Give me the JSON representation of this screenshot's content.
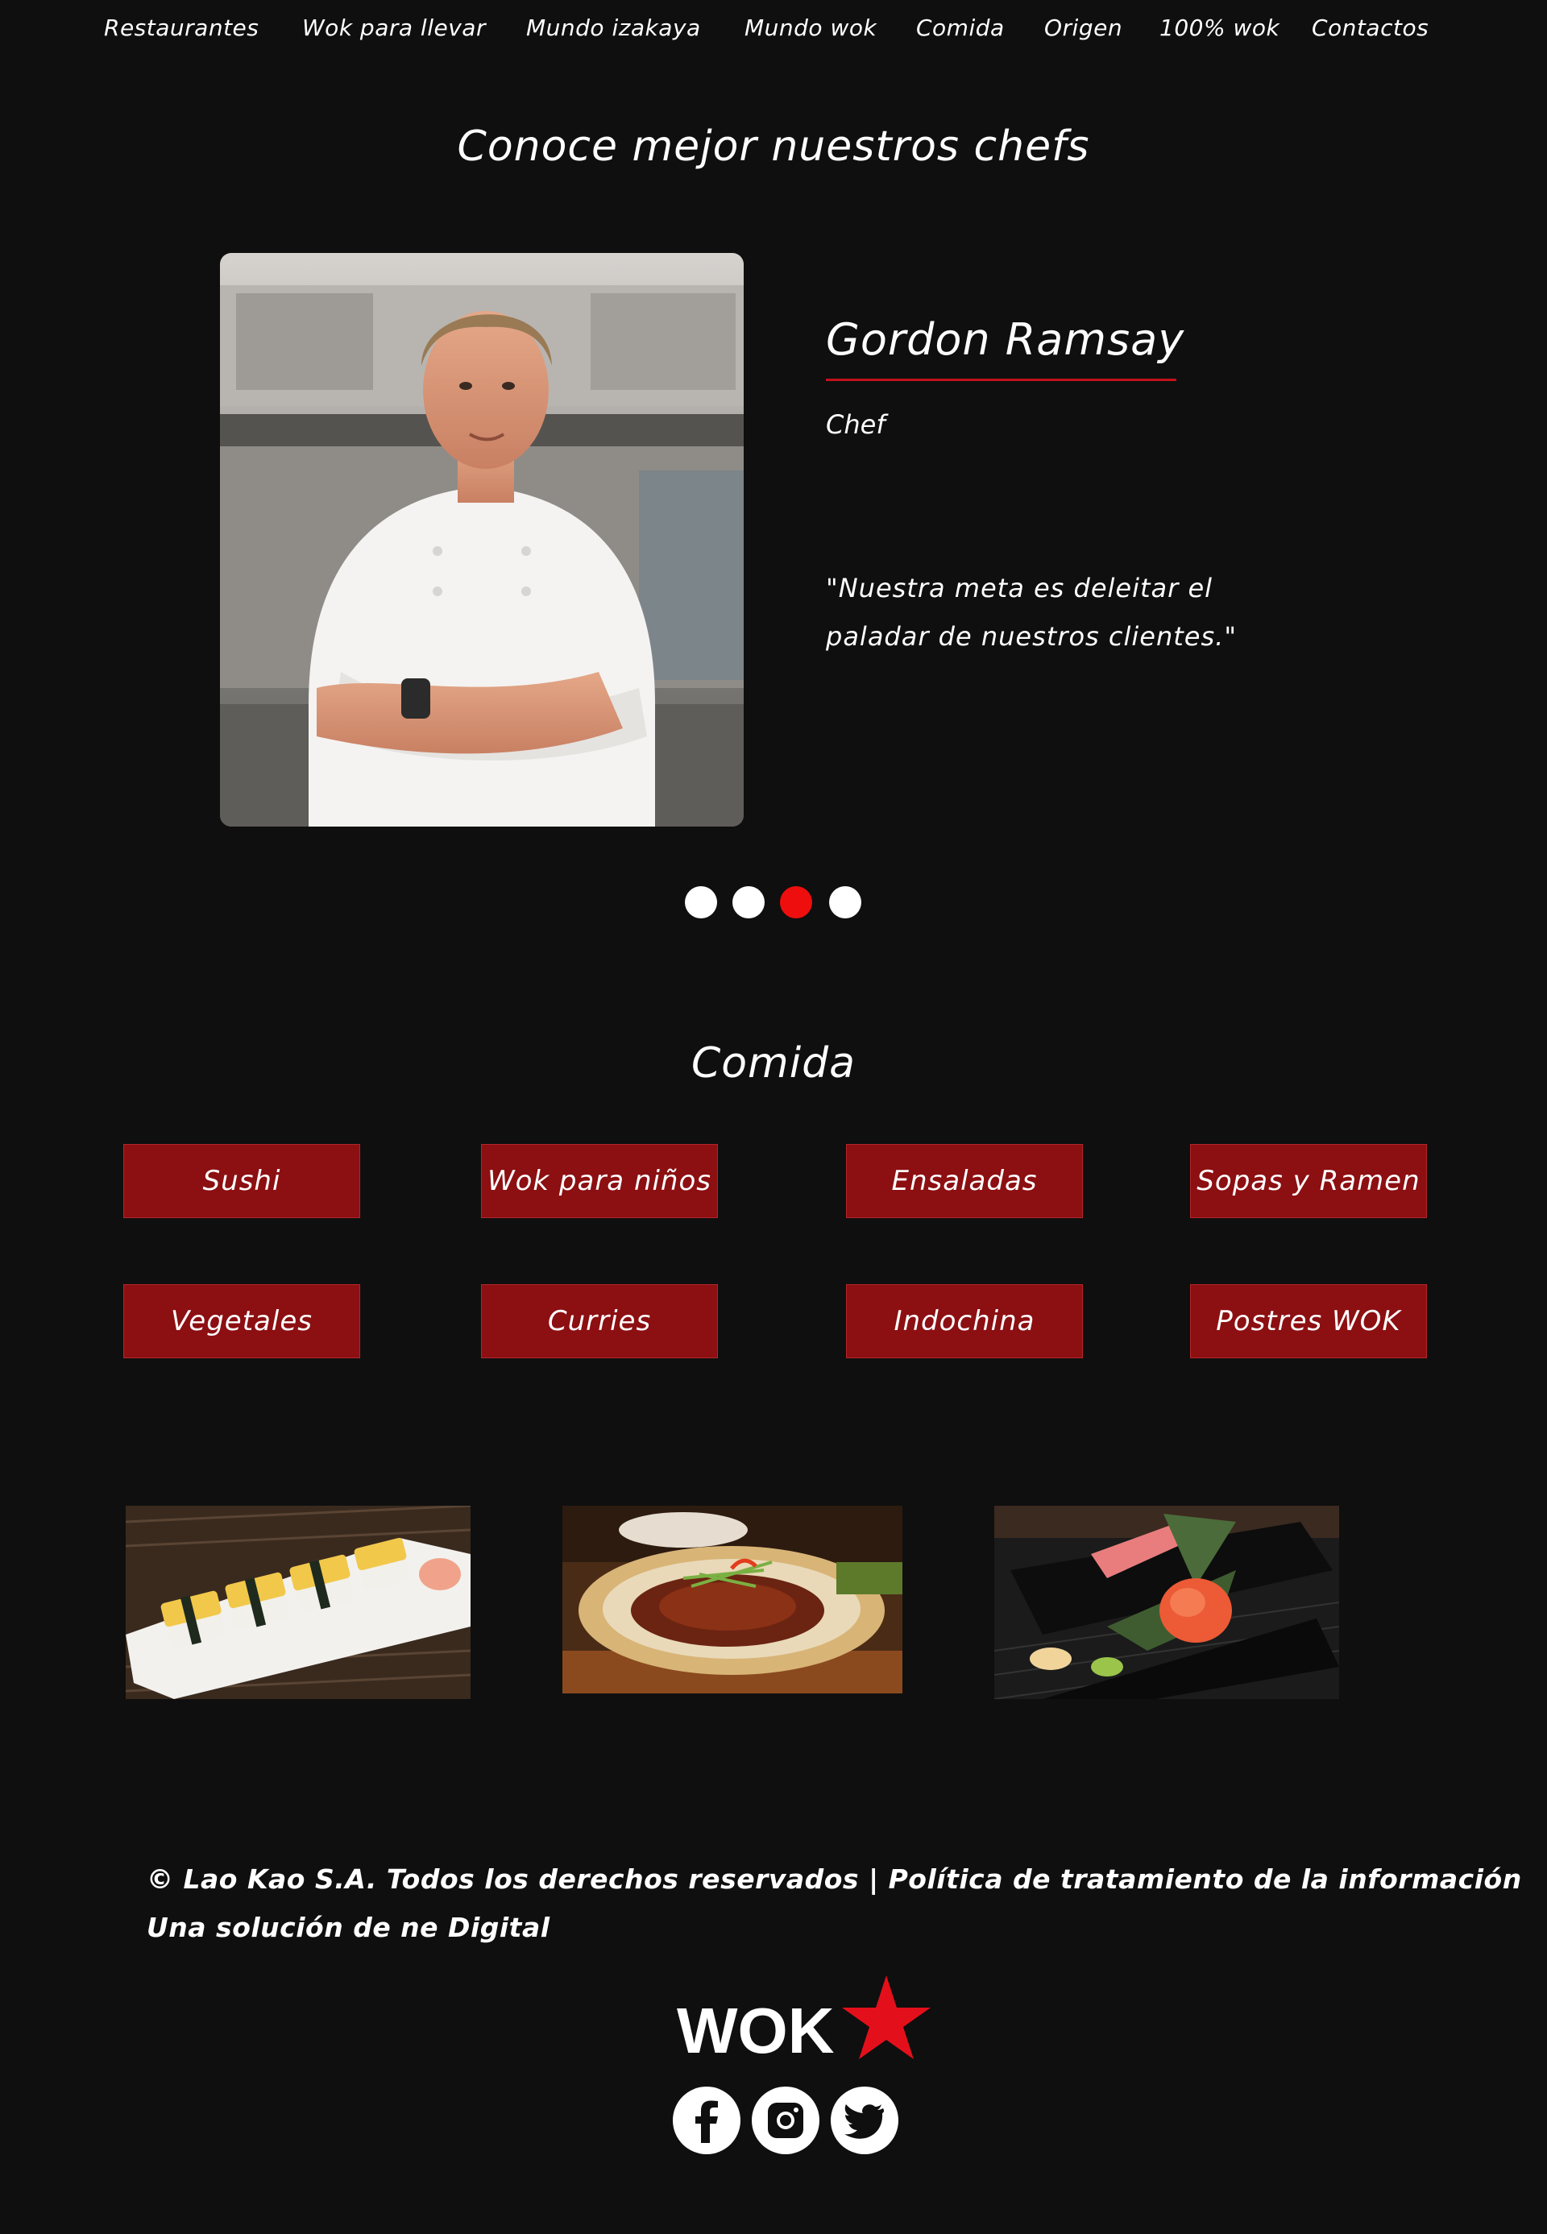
{
  "nav": {
    "items": [
      "Restaurantes",
      "Wok para llevar",
      "Mundo izakaya",
      "Mundo wok",
      "Comida",
      "Origen",
      "100% wok",
      "Contactos"
    ]
  },
  "chefs": {
    "title": "Conoce mejor nuestros chefs",
    "name": "Gordon Ramsay",
    "role": "Chef",
    "quote_line1": "\"Nuestra meta es deleitar el",
    "quote_line2": "paladar de nuestros clientes.\"",
    "active_slide": 3,
    "slide_count": 4
  },
  "comida": {
    "title": "Comida",
    "buttons": [
      "Sushi",
      "Wok para niños",
      "Ensaladas",
      "Sopas y Ramen",
      "Vegetales",
      "Curries",
      "Indochina",
      "Postres WOK"
    ]
  },
  "gallery": {
    "images": [
      "tamago-sushi-photo",
      "glazed-dish-photo",
      "temaki-hand-roll-photo"
    ]
  },
  "footer": {
    "line1": "© Lao Kao S.A. Todos los derechos reservados | Política de tratamiento de la información",
    "line2": "Una solución de ne Digital",
    "logo_text": "WOK",
    "social": [
      "facebook-icon",
      "instagram-icon",
      "twitter-icon"
    ]
  },
  "colors": {
    "background": "#0f0f0f",
    "accent_red": "#c3121b",
    "button_red": "#8c0f12",
    "active_dot": "#ee0e0e",
    "star_red": "#e3101b"
  }
}
